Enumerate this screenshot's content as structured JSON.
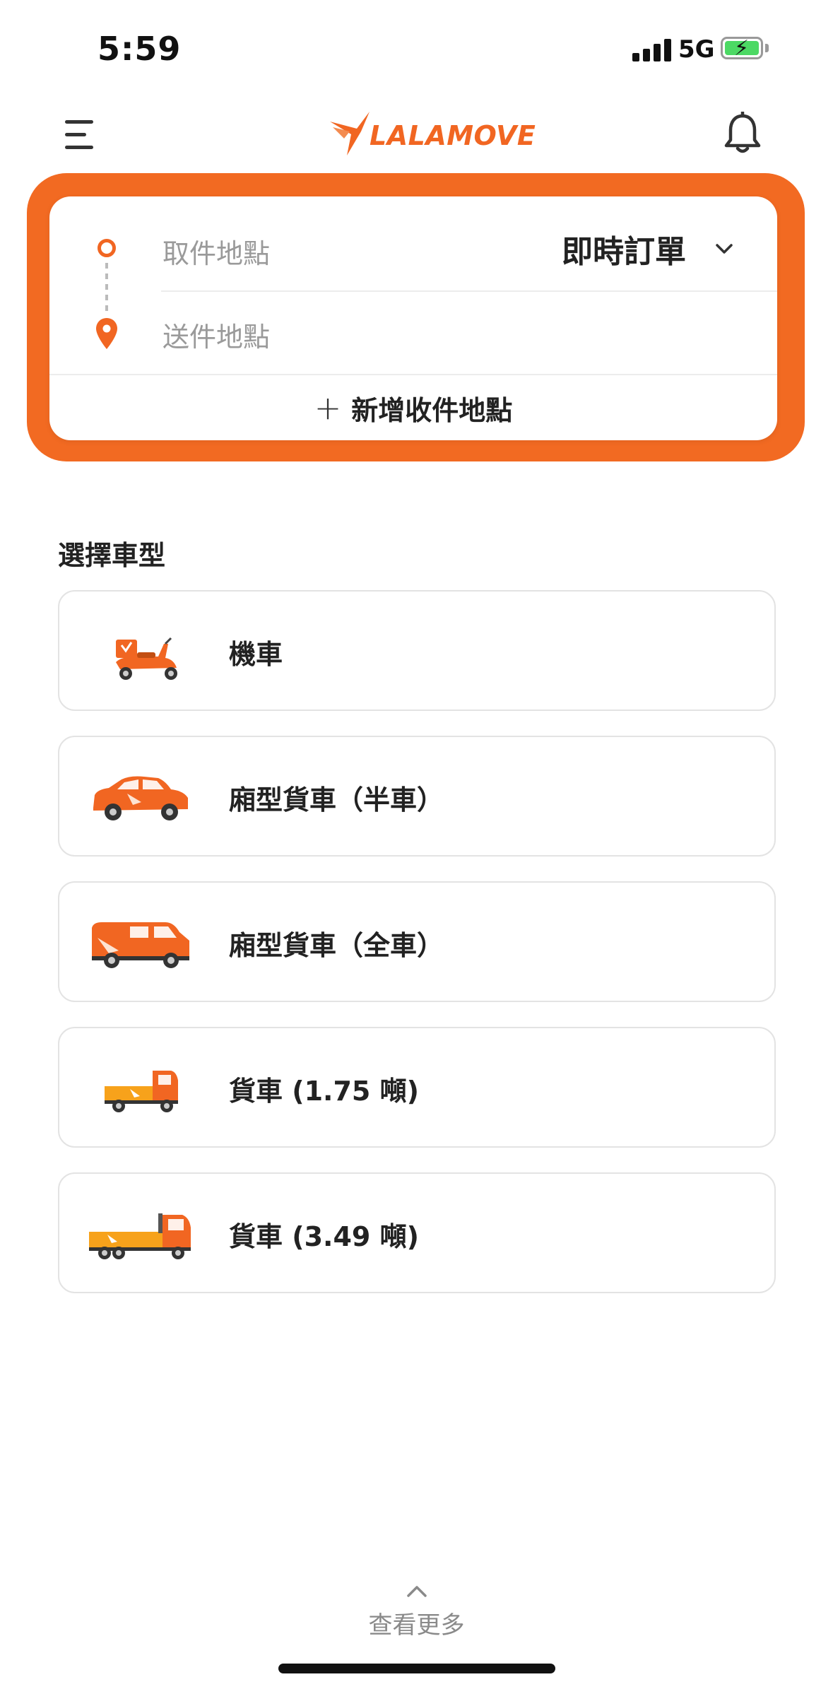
{
  "status_bar": {
    "time": "5:59",
    "network": "5G"
  },
  "header": {
    "logo_text": "LALAMOVE",
    "brand_color": "#f16622"
  },
  "route": {
    "pickup_placeholder": "取件地點",
    "dropoff_placeholder": "送件地點",
    "order_type": "即時訂單",
    "add_stop": "新增收件地點"
  },
  "vehicles": {
    "title": "選擇車型",
    "items": [
      {
        "label": "機車",
        "icon": "motorcycle-icon"
      },
      {
        "label": "廂型貨車（半車）",
        "icon": "suv-icon"
      },
      {
        "label": "廂型貨車（全車）",
        "icon": "van-icon"
      },
      {
        "label": "貨車 (1.75 噸)",
        "icon": "small-truck-icon"
      },
      {
        "label": "貨車 (3.49 噸)",
        "icon": "large-truck-icon"
      }
    ]
  },
  "footer": {
    "see_more": "查看更多"
  }
}
